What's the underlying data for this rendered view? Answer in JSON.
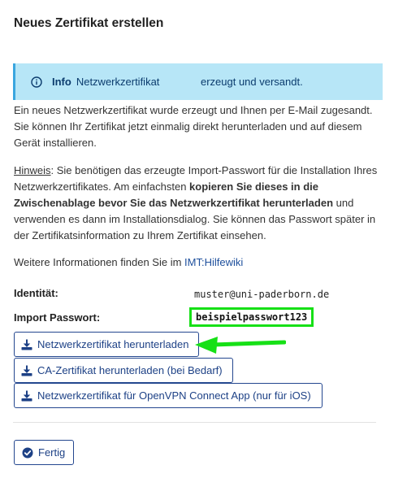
{
  "title": "Neues Zertifikat erstellen",
  "info": {
    "label": "Info",
    "message": "Netzwerkzertifikat              erzeugt und versandt.",
    "icon": "info-circle-icon"
  },
  "para1": "Ein neues Netzwerkzertifikat wurde erzeugt und Ihnen per E-Mail zugesandt. Sie können Ihr Zertifikat jetzt einmalig direkt herunterladen und auf diesem Gerät installieren.",
  "para2": {
    "hint_label": "Hinweis",
    "part1": ": Sie benötigen das erzeugte Import-Passwort für die Installation Ihres Netzwerkzertifikates. Am einfachsten ",
    "bold": "kopieren Sie dieses in die Zwischenablage bevor Sie das Netzwerkzertifikat herunterladen",
    "part2": " und verwenden es dann im Installationsdialog. Sie können das Passwort später in der Zertifikatsinformation zu Ihrem Zertifikat einsehen."
  },
  "para3": {
    "text": "Weitere Informationen finden Sie im ",
    "link": "IMT:Hilfewiki"
  },
  "identity": {
    "label": "Identität:",
    "value": "muster@uni-paderborn.de"
  },
  "password": {
    "label": "Import Passwort:",
    "value": "beispielpasswort123"
  },
  "buttons": {
    "download_cert": "Netzwerkzertifikat herunterladen",
    "download_ca": "CA-Zertifikat herunterladen (bei Bedarf)",
    "download_openvpn": "Netzwerkzertifikat für OpenVPN Connect App (nur für iOS)",
    "done": "Fertig"
  },
  "colors": {
    "info_bg": "#b7e6f7",
    "info_border": "#3aa6df",
    "button_border": "#24478f",
    "highlight": "#16e016"
  }
}
